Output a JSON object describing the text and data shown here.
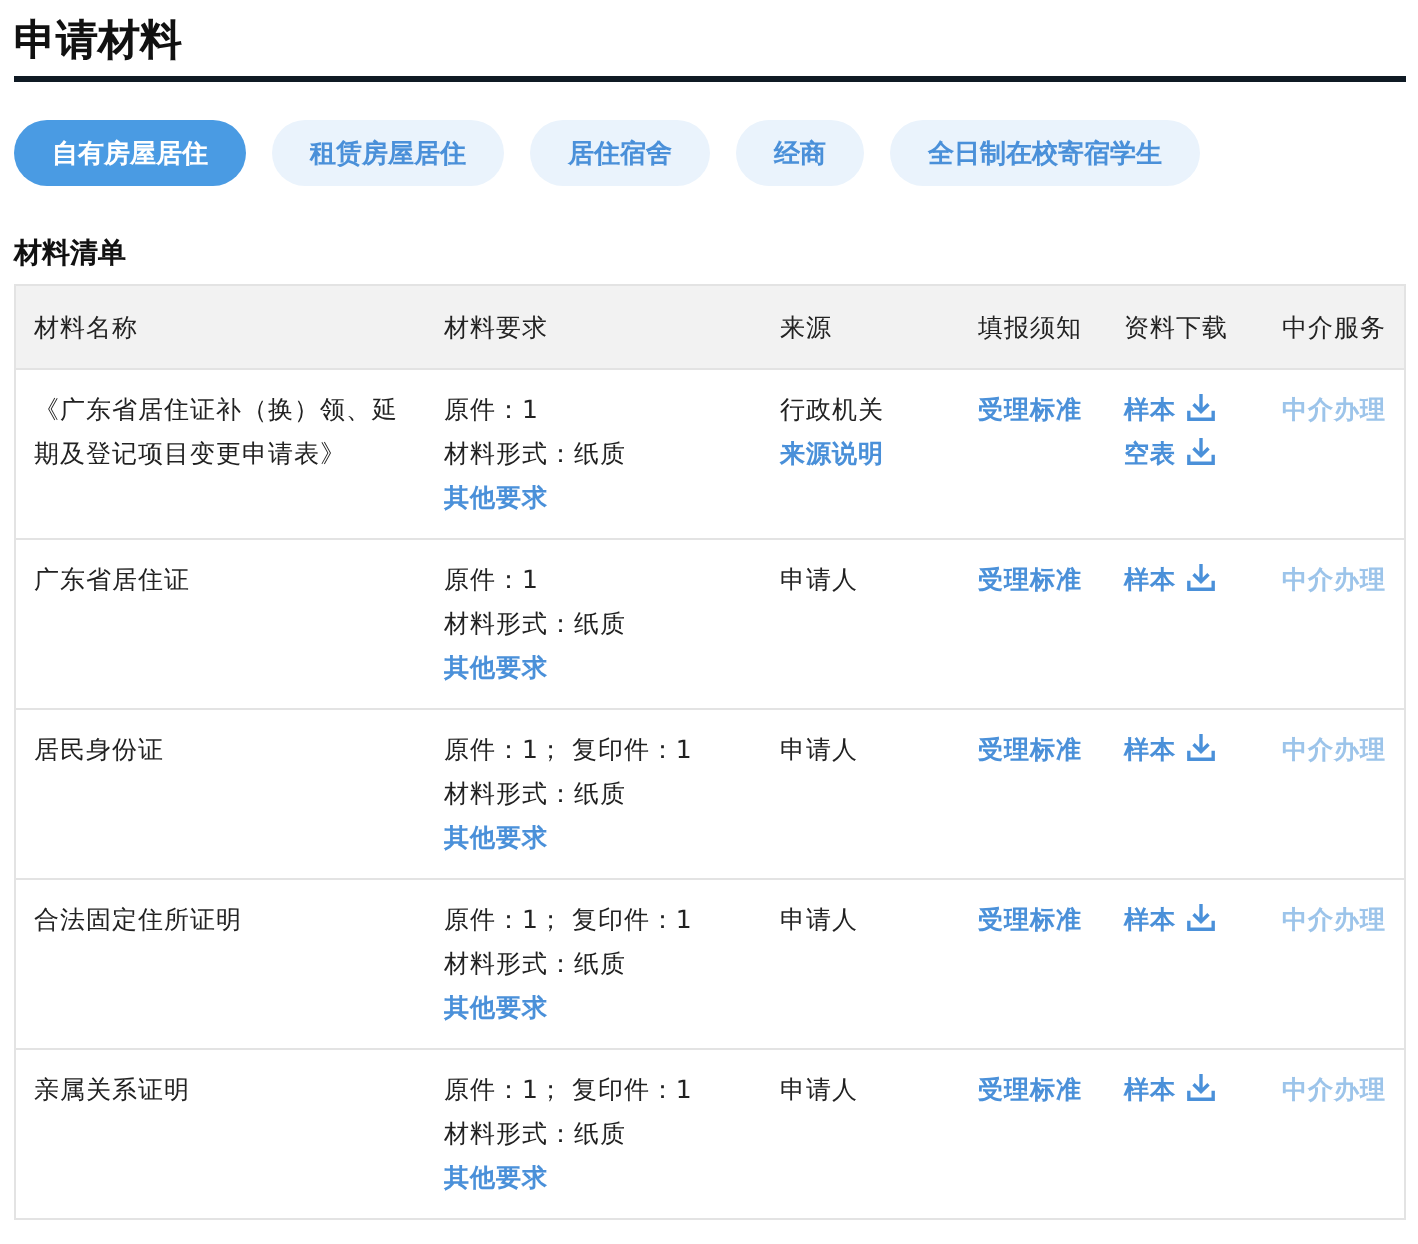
{
  "title": "申请材料",
  "tabs": [
    {
      "label": "自有房屋居住",
      "selected": true
    },
    {
      "label": "租赁房屋居住",
      "selected": false
    },
    {
      "label": "居住宿舍",
      "selected": false
    },
    {
      "label": "经商",
      "selected": false
    },
    {
      "label": "全日制在校寄宿学生",
      "selected": false
    }
  ],
  "section_title": "材料清单",
  "table": {
    "columns": [
      "材料名称",
      "材料要求",
      "来源",
      "填报须知",
      "资料下载",
      "中介服务"
    ],
    "rows": [
      {
        "name": "《广东省居住证补（换）领、延期及登记项目变更申请表》",
        "requirements": [
          "原件：1",
          "材料形式：纸质"
        ],
        "other_link": "其他要求",
        "source": "行政机关",
        "source_link": "来源说明",
        "notice": "受理标准",
        "downloads": [
          "样本",
          "空表"
        ],
        "agent": {
          "label": "中介办理",
          "disabled": true
        }
      },
      {
        "name": "广东省居住证",
        "requirements": [
          "原件：1",
          "材料形式：纸质"
        ],
        "other_link": "其他要求",
        "source": "申请人",
        "notice": "受理标准",
        "downloads": [
          "样本"
        ],
        "agent": {
          "label": "中介办理",
          "disabled": true
        }
      },
      {
        "name": "居民身份证",
        "requirements": [
          "原件：1； 复印件：1",
          "材料形式：纸质"
        ],
        "other_link": "其他要求",
        "source": "申请人",
        "notice": "受理标准",
        "downloads": [
          "样本"
        ],
        "agent": {
          "label": "中介办理",
          "disabled": true
        }
      },
      {
        "name": "合法固定住所证明",
        "requirements": [
          "原件：1； 复印件：1",
          "材料形式：纸质"
        ],
        "other_link": "其他要求",
        "source": "申请人",
        "notice": "受理标准",
        "downloads": [
          "样本"
        ],
        "agent": {
          "label": "中介办理",
          "disabled": true
        }
      },
      {
        "name": "亲属关系证明",
        "requirements": [
          "原件：1； 复印件：1",
          "材料形式：纸质"
        ],
        "other_link": "其他要求",
        "source": "申请人",
        "notice": "受理标准",
        "downloads": [
          "样本"
        ],
        "agent": {
          "label": "中介办理",
          "disabled": true
        }
      }
    ]
  }
}
